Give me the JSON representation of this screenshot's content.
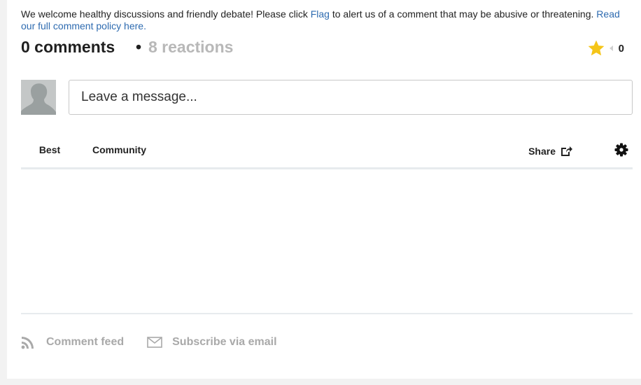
{
  "policy": {
    "text_before_flag": "We welcome healthy discussions and friendly debate! Please click ",
    "flag_link": "Flag",
    "text_after_flag": " to alert us of a comment that may be abusive or threatening. ",
    "policy_link": "Read our full comment policy here."
  },
  "header": {
    "comment_count": "0 comments",
    "separator": "•",
    "reactions": "8 reactions",
    "rating_count": "0"
  },
  "composer": {
    "placeholder": "Leave a message..."
  },
  "tabs": {
    "best": "Best",
    "community": "Community",
    "share": "Share"
  },
  "footer": {
    "comment_feed": "Comment feed",
    "subscribe": "Subscribe via email"
  },
  "colors": {
    "link": "#2e6bb0",
    "star": "#f5c518",
    "muted": "#a9a9a9"
  }
}
